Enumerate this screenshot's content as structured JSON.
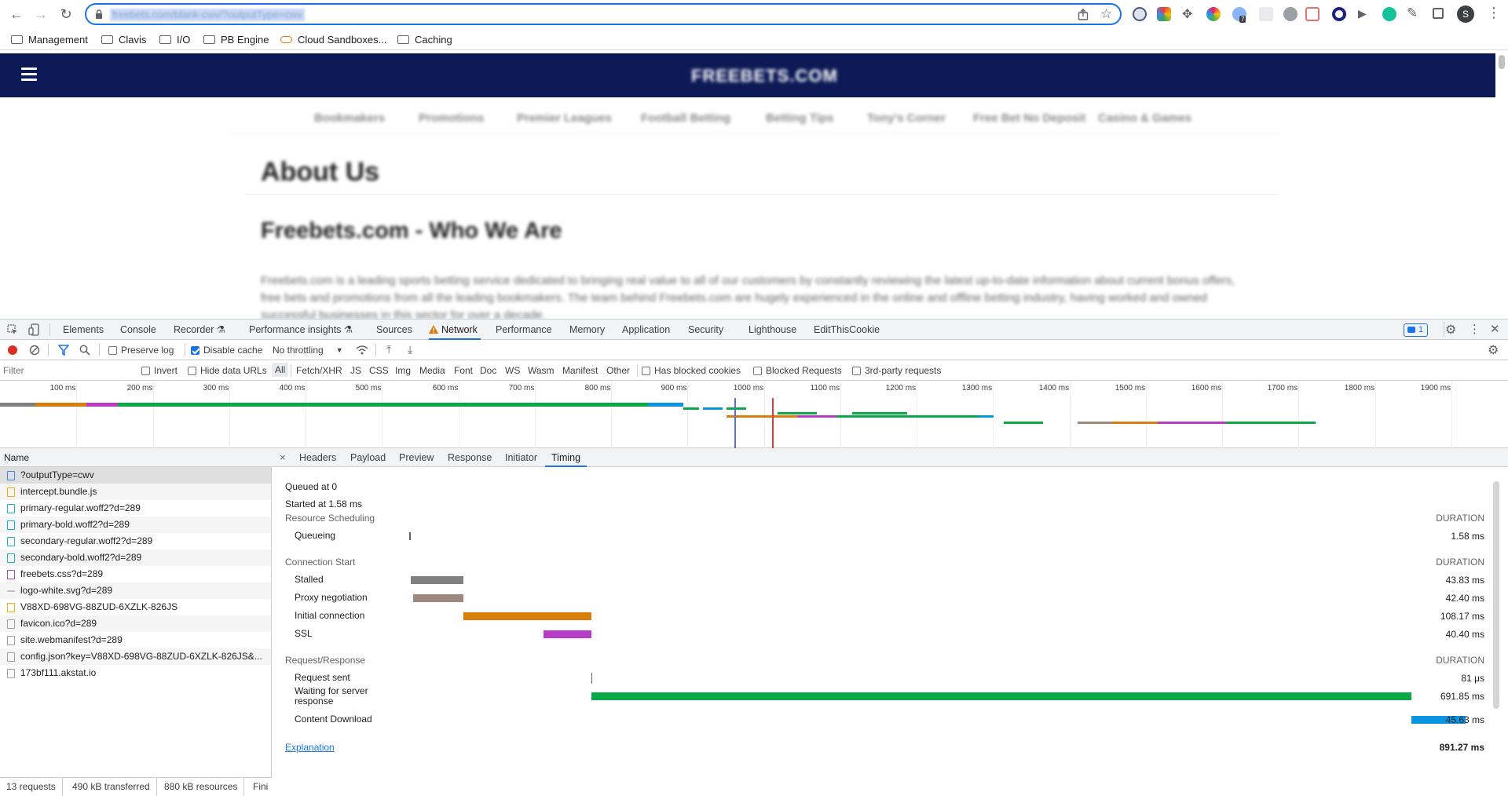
{
  "browser": {
    "url": "freebets.com/blank-cwv/?outputType=cwv",
    "bookmarks": [
      "Management",
      "Clavis",
      "I/O",
      "PB Engine",
      "Cloud Sandboxes...",
      "Caching"
    ],
    "profile_initial": "S",
    "extension_badge": "7"
  },
  "page": {
    "logo": "FREEBETS.COM",
    "menu": [
      "Bookmakers",
      "Promotions",
      "Premier Leagues",
      "Football Betting",
      "Betting Tips",
      "Tony's Corner",
      "Free Bet No Deposit",
      "Casino & Games"
    ],
    "h1": "About Us",
    "h2": "Freebets.com - Who We Are",
    "para": "Freebets.com is a leading sports betting service dedicated to bringing real value to all of our customers by constantly reviewing the latest up-to-date information about current bonus offers, free bets and promotions from all the leading bookmakers. The team behind Freebets.com are hugely experienced in the online and offline betting industry, having worked and owned successful businesses in this sector for over a decade."
  },
  "devtools": {
    "tabs": [
      "Elements",
      "Console",
      "Recorder ⚗",
      "Performance insights ⚗",
      "Sources",
      "Network",
      "Performance",
      "Memory",
      "Application",
      "Security",
      "Lighthouse",
      "EditThisCookie"
    ],
    "active_tab": "Network",
    "issues_count": "1",
    "toolbar": {
      "preserve_log": "Preserve log",
      "disable_cache": "Disable cache",
      "throttling": "No throttling"
    },
    "filter": {
      "placeholder": "Filter",
      "invert": "Invert",
      "hide_data_urls": "Hide data URLs",
      "types": [
        "All",
        "Fetch/XHR",
        "JS",
        "CSS",
        "Img",
        "Media",
        "Font",
        "Doc",
        "WS",
        "Wasm",
        "Manifest",
        "Other"
      ],
      "has_blocked_cookies": "Has blocked cookies",
      "blocked_requests": "Blocked Requests",
      "third_party": "3rd-party requests"
    },
    "overview_ticks": [
      "100 ms",
      "200 ms",
      "300 ms",
      "400 ms",
      "500 ms",
      "600 ms",
      "700 ms",
      "800 ms",
      "900 ms",
      "1000 ms",
      "1100 ms",
      "1200 ms",
      "1300 ms",
      "1400 ms",
      "1500 ms",
      "1600 ms",
      "1700 ms",
      "1800 ms",
      "1900 ms",
      "20"
    ],
    "list_header": "Name",
    "requests": [
      {
        "name": "?outputType=cwv",
        "type": "doc"
      },
      {
        "name": "intercept.bundle.js",
        "type": "js"
      },
      {
        "name": "primary-regular.woff2?d=289",
        "type": "font"
      },
      {
        "name": "primary-bold.woff2?d=289",
        "type": "font"
      },
      {
        "name": "secondary-regular.woff2?d=289",
        "type": "font"
      },
      {
        "name": "secondary-bold.woff2?d=289",
        "type": "font"
      },
      {
        "name": "freebets.css?d=289",
        "type": "css"
      },
      {
        "name": "logo-white.svg?d=289",
        "type": "img"
      },
      {
        "name": "V88XD-698VG-88ZUD-6XZLK-826JS",
        "type": "js"
      },
      {
        "name": "favicon.ico?d=289",
        "type": "other"
      },
      {
        "name": "site.webmanifest?d=289",
        "type": "other"
      },
      {
        "name": "config.json?key=V88XD-698VG-88ZUD-6XZLK-826JS&...",
        "type": "other"
      },
      {
        "name": "173bf111.akstat.io",
        "type": "other"
      }
    ],
    "status": {
      "requests": "13 requests",
      "transferred": "490 kB transferred",
      "resources": "880 kB resources",
      "finish": "Fini"
    },
    "detail_tabs": [
      "Headers",
      "Payload",
      "Preview",
      "Response",
      "Initiator",
      "Timing"
    ],
    "active_detail_tab": "Timing",
    "timing": {
      "queued_at": "Queued at 0",
      "started_at": "Started at 1.58 ms",
      "duration_label": "DURATION",
      "total_ms": 891.27,
      "sections": [
        {
          "title": "Resource Scheduling",
          "rows": [
            {
              "label": "Queueing",
              "start_ms": 0,
              "dur_ms": 1.58,
              "duration": "1.58 ms",
              "color": "#5f6368"
            }
          ]
        },
        {
          "title": "Connection Start",
          "rows": [
            {
              "label": "Stalled",
              "start_ms": 1.58,
              "dur_ms": 43.83,
              "duration": "43.83 ms",
              "color": "#808080"
            },
            {
              "label": "Proxy negotiation",
              "start_ms": 3.0,
              "dur_ms": 42.4,
              "duration": "42.40 ms",
              "color": "#a1887f"
            },
            {
              "label": "Initial connection",
              "start_ms": 45.41,
              "dur_ms": 108.17,
              "duration": "108.17 ms",
              "color": "#d97d0d"
            },
            {
              "label": "SSL",
              "start_ms": 113.18,
              "dur_ms": 40.4,
              "duration": "40.40 ms",
              "color": "#b73dc6"
            }
          ]
        },
        {
          "title": "Request/Response",
          "rows": [
            {
              "label": "Request sent",
              "start_ms": 153.58,
              "dur_ms": 0.081,
              "duration": "81 μs",
              "color": "#5f6368"
            },
            {
              "label": "Waiting for server response",
              "start_ms": 153.66,
              "dur_ms": 691.85,
              "duration": "691.85 ms",
              "color": "#0ba84a"
            },
            {
              "label": "Content Download",
              "start_ms": 845.51,
              "dur_ms": 45.63,
              "duration": "45.63 ms",
              "color": "#0a95e0"
            }
          ]
        }
      ],
      "explanation": "Explanation",
      "total": "891.27 ms"
    }
  }
}
